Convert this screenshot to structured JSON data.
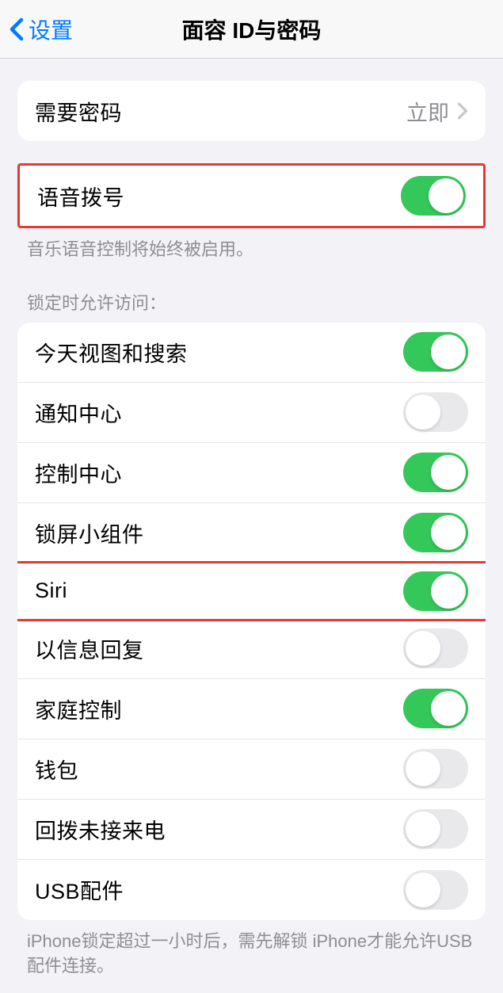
{
  "header": {
    "back_label": "设置",
    "title": "面容 ID与密码"
  },
  "passcode_row": {
    "label": "需要密码",
    "value": "立即"
  },
  "voice_dial": {
    "label": "语音拨号",
    "on": true,
    "footer": "音乐语音控制将始终被启用。"
  },
  "lock_section_header": "锁定时允许访问：",
  "lock_items": [
    {
      "label": "今天视图和搜索",
      "on": true
    },
    {
      "label": "通知中心",
      "on": false
    },
    {
      "label": "控制中心",
      "on": true
    },
    {
      "label": "锁屏小组件",
      "on": true
    },
    {
      "label": "Siri",
      "on": true,
      "highlighted": true
    },
    {
      "label": "以信息回复",
      "on": false
    },
    {
      "label": "家庭控制",
      "on": true
    },
    {
      "label": "钱包",
      "on": false
    },
    {
      "label": "回拨未接来电",
      "on": false
    },
    {
      "label": "USB配件",
      "on": false
    }
  ],
  "lock_footer": "iPhone锁定超过一小时后，需先解锁 iPhone才能允许USB配件连接。"
}
